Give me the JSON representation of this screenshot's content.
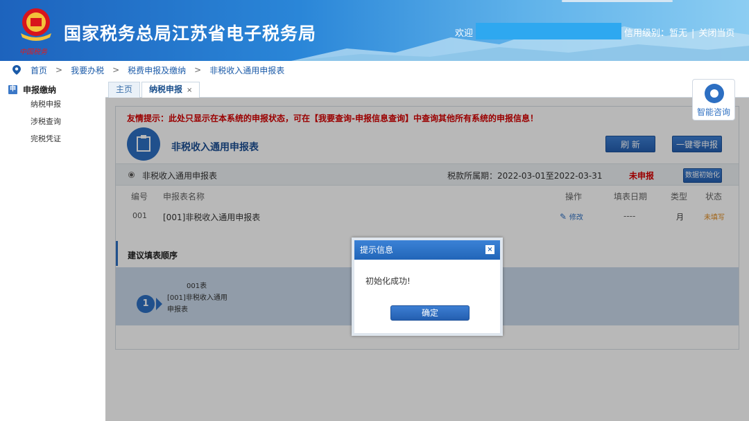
{
  "header": {
    "site_title": "国家税务总局江苏省电子税务局",
    "logo_caption": "中国税务",
    "welcome": "欢迎",
    "credit_label": "信用级别：暂无",
    "close_page": "关闭当页"
  },
  "breadcrumb": [
    "首页",
    "我要办税",
    "税费申报及缴纳",
    "非税收入通用申报表"
  ],
  "sidebar": {
    "section_icon": "申",
    "section_title": "申报缴纳",
    "items": [
      "纳税申报",
      "涉税查询",
      "完税凭证"
    ]
  },
  "tabs": {
    "home": "主页",
    "active": "纳税申报",
    "close_glyph": "×"
  },
  "consult": {
    "label": "智能咨询"
  },
  "panel": {
    "notice": "友情提示：此处只显示在本系统的申报状态，可在【我要查询-申报信息查询】中查询其他所有系统的申报信息！",
    "form_title": "非税收入通用申报表",
    "refresh_button": "刷 新",
    "zero_button": "一键零申报",
    "sub_name": "非税收入通用申报表",
    "period": "税款所属期：2022-03-01至2022-03-31",
    "status": "未申报",
    "init_button": "数据初始化",
    "columns": [
      "编号",
      "申报表名称",
      "操作",
      "填表日期",
      "类型",
      "状态"
    ],
    "row": {
      "no": "001",
      "name": "[001]非税收入通用申报表",
      "op": "修改",
      "date": "----",
      "type": "月",
      "status": "未填写"
    },
    "suggest_title": "建议填表顺序",
    "step": {
      "num": "1",
      "line1": "001表",
      "line2": "[001]非税收入通用",
      "line3": "申报表"
    }
  },
  "modal": {
    "title": "提示信息",
    "close_glyph": "×",
    "message": "初始化成功!",
    "ok": "确定"
  },
  "colors": {
    "primary": "#2d6fc2",
    "notice": "#d60000",
    "header_start": "#1d63bd"
  }
}
